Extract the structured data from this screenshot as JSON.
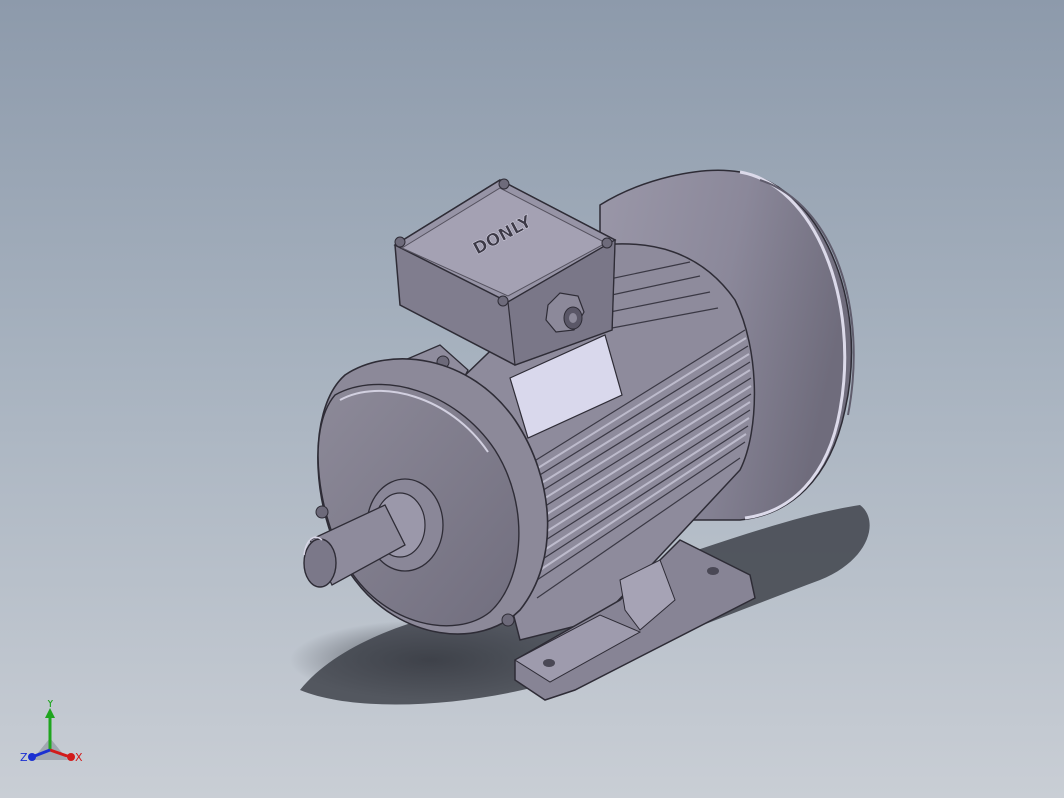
{
  "viewport": {
    "background_top": "#8d9aab",
    "background_bottom": "#c9ced5"
  },
  "model": {
    "brand_label": "DONLY",
    "body_color": "#8a8796",
    "shadow_color": "#4c505a",
    "highlight_color": "#d8d6e6"
  },
  "triad": {
    "x_label": "X",
    "y_label": "Y",
    "z_label": "Z",
    "x_color": "#d21a1a",
    "y_color": "#1fa51f",
    "z_color": "#1a2fd2"
  }
}
